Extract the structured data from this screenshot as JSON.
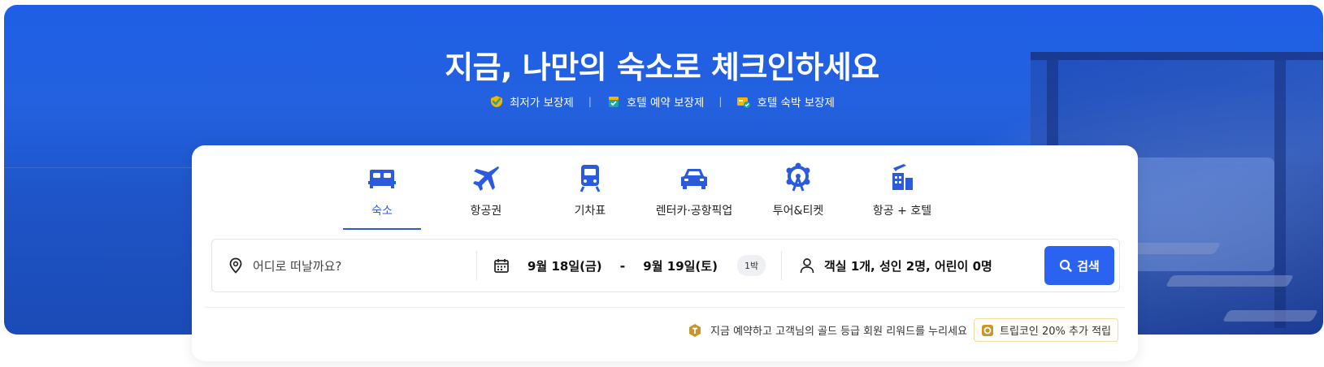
{
  "hero": {
    "title": "지금, 나만의 숙소로 체크인하세요",
    "guarantees": [
      {
        "icon": "check-badge-icon",
        "label": "최저가 보장제"
      },
      {
        "icon": "calendar-check-icon",
        "label": "호텔 예약 보장제"
      },
      {
        "icon": "hotel-stay-icon",
        "label": "호텔 숙박 보장제"
      }
    ],
    "separator": "|"
  },
  "tabs": [
    {
      "icon": "bed-icon",
      "label": "숙소",
      "active": true
    },
    {
      "icon": "airplane-icon",
      "label": "항공권",
      "active": false
    },
    {
      "icon": "train-icon",
      "label": "기차표",
      "active": false
    },
    {
      "icon": "car-icon",
      "label": "렌터카·공항픽업",
      "active": false
    },
    {
      "icon": "ferris-wheel-icon",
      "label": "투어&티켓",
      "active": false
    },
    {
      "icon": "flight-hotel-icon",
      "label": "항공 + 호텔",
      "active": false
    }
  ],
  "search": {
    "destination_placeholder": "어디로 떠날까요?",
    "checkin": "9월 18일(금)",
    "date_separator": "-",
    "checkout": "9월 19일(토)",
    "nights": "1박",
    "guests": "객실 1개, 성인 2명, 어린이 0명",
    "button_label": "검색"
  },
  "promo": {
    "text": "지금 예약하고 고객님의 골드 등급 회원 리워드를 누리세요",
    "coin_text": "트립코인 20% 추가 적립"
  },
  "colors": {
    "accent": "#2a63f2",
    "hero_blue": "#2361df",
    "active_tab": "#2b5bdc",
    "gold": "#c9962b"
  }
}
